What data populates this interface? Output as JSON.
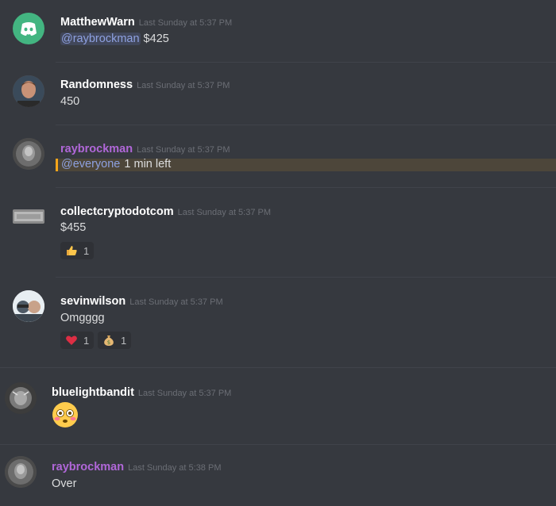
{
  "messages": [
    {
      "username": "MatthewWarn",
      "timestamp": "Last Sunday at 5:37 PM",
      "mention": "@raybrockman",
      "text": " $425"
    },
    {
      "username": "Randomness",
      "timestamp": "Last Sunday at 5:37 PM",
      "text": "450"
    },
    {
      "username": "raybrockman",
      "timestamp": "Last Sunday at 5:37 PM",
      "mention": "@everyone",
      "text": " 1 min left"
    },
    {
      "username": "collectcryptodotcom",
      "timestamp": "Last Sunday at 5:37 PM",
      "text": "$455",
      "reactions": [
        {
          "emoji": "thumbs-up",
          "count": "1"
        }
      ]
    },
    {
      "username": "sevinwilson",
      "timestamp": "Last Sunday at 5:37 PM",
      "text": "Omgggg",
      "reactions": [
        {
          "emoji": "heart",
          "count": "1"
        },
        {
          "emoji": "money-bag",
          "count": "1"
        }
      ]
    },
    {
      "username": "bluelightbandit",
      "timestamp": "Last Sunday at 5:37 PM",
      "emoji": "flushed-face"
    },
    {
      "username": "raybrockman",
      "timestamp": "Last Sunday at 5:38 PM",
      "text": "Over"
    }
  ],
  "colors": {
    "background": "#36393f",
    "username_default": "#ffffff",
    "username_purple": "#b067d8",
    "mention": "#8ea1e1",
    "highlight_bar": "#faa61a",
    "discord_avatar": "#43b581"
  }
}
